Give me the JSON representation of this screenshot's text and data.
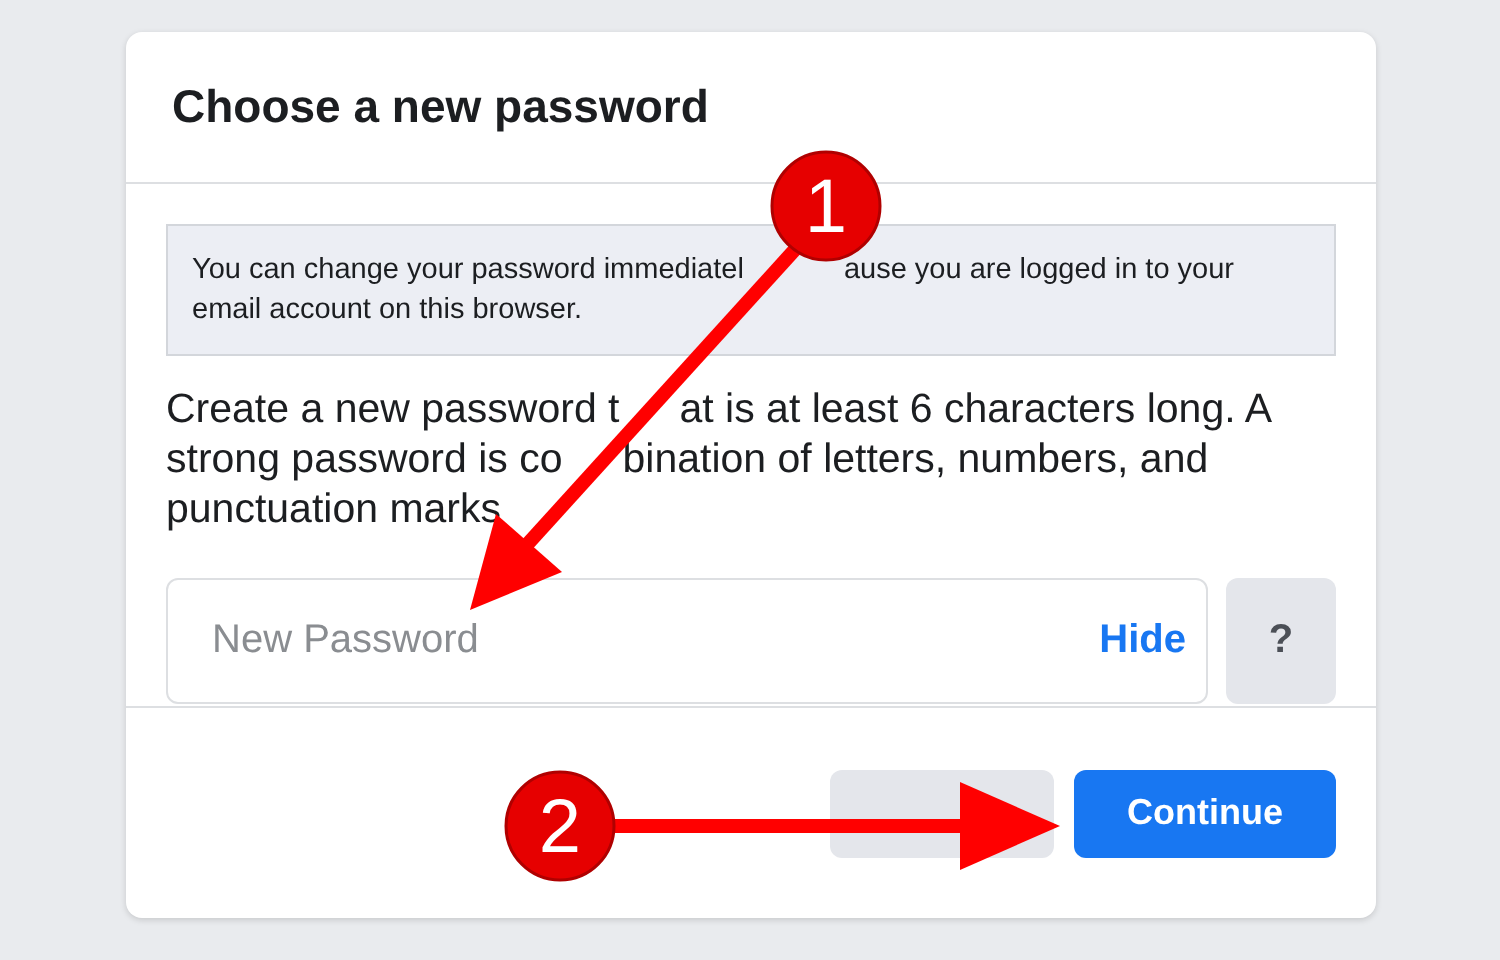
{
  "dialog": {
    "title": "Choose a new password",
    "notice": [
      [
        "You can change your password immediatel",
        "ause you are logged in to your"
      ],
      [
        "email account on this browser."
      ]
    ],
    "instructions": [
      [
        "Create a new password t",
        "at is at least 6 characters long. A"
      ],
      [
        "strong password is co",
        "bination of letters, numbers, and"
      ],
      [
        "punctuation marks"
      ]
    ],
    "password_field": {
      "placeholder": "New Password",
      "toggle": "Hide"
    },
    "help_button": "?",
    "buttons": [
      {
        "kind": "secondary"
      },
      {
        "label": "Continue",
        "kind": "primary"
      }
    ]
  },
  "annotations": [
    {
      "label": "1"
    },
    {
      "label": "2"
    }
  ]
}
